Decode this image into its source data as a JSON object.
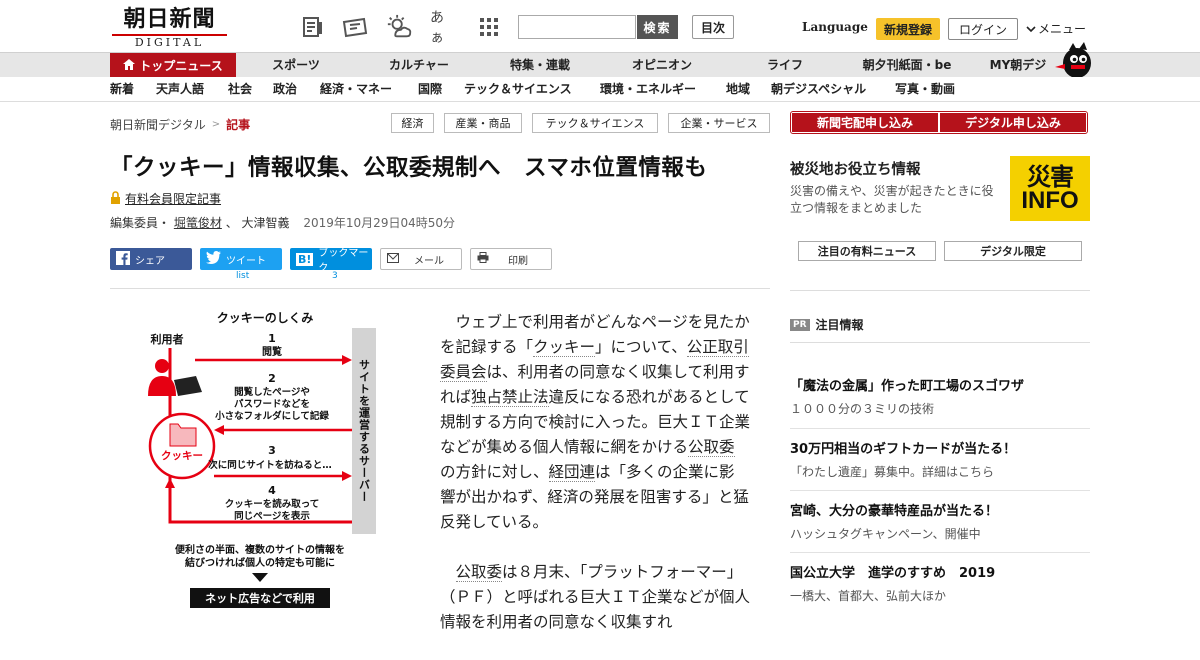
{
  "header": {
    "logo_jp": "朝日新聞",
    "logo_en": "DIGITAL",
    "search_placeholder": "",
    "search_button": "検索",
    "mokuji": "目次",
    "language": "Language",
    "register": "新規登録",
    "login": "ログイン",
    "menu": "メニュー",
    "font_size_label": "あぁ"
  },
  "nav_main": {
    "top": "トップニュース",
    "items": [
      "スポーツ",
      "カルチャー",
      "特集・連載",
      "オピニオン",
      "ライフ",
      "朝夕刊紙面・be",
      "MY朝デジ"
    ]
  },
  "nav_sub": {
    "items": [
      "新着",
      "天声人語",
      "社会",
      "政治",
      "経済・マネー",
      "国際",
      "テック＆サイエンス",
      "環境・エネルギー",
      "地域",
      "朝デジスペシャル",
      "写真・動画"
    ]
  },
  "breadcrumb": {
    "home": "朝日新聞デジタル",
    "sep": ">",
    "current": "記事"
  },
  "tags": [
    "経済",
    "産業・商品",
    "テック＆サイエンス",
    "企業・サービス"
  ],
  "article": {
    "headline": "「クッキー」情報収集、公取委規制へ　スマホ位置情報も",
    "members_only": "有料会員限定記事",
    "byline_prefix": "編集委員・",
    "author1": "堀篭俊材",
    "byline_sep": "、",
    "author2": "大津智義",
    "datetime": "2019年10月29日04時50分",
    "p1_a": "ウェブ上で利用者がどんなページを見たかを記録する「",
    "p1_link1": "クッキー",
    "p1_b": "」について、",
    "p1_link2": "公正取引委員会",
    "p1_c": "は、利用者の同意なく収集して利用すれば",
    "p1_link3": "独占禁止法",
    "p1_d": "違反になる恐れがあるとして規制する方向で検討に入った。巨大ＩＴ企業などが集める個人情報に網をかける",
    "p1_link4": "公取委",
    "p1_e": "の方針に対し、",
    "p1_link5": "経団連",
    "p1_f": "は「多くの企業に影響が出かねず、経済の発展を阻害する」と猛反発している。",
    "p2_link1": "公取委",
    "p2_a": "は８月末、「プラットフォーマー」（ＰＦ）と呼ばれる巨大ＩＴ企業などが個人情報を利用者の同意なく収集すれ"
  },
  "share": {
    "facebook": "シェア",
    "twitter": "ツイート",
    "twitter_count": "list",
    "hatena": "ブックマーク",
    "hatena_count": "3",
    "mail": "メール",
    "print": "印刷",
    "hatena_icon": "B!"
  },
  "figure": {
    "title": "クッキーのしくみ",
    "user_label": "利用者",
    "server_label": "サイトを運営するサーバー",
    "cookie_label": "クッキー",
    "step1_num": "1",
    "step1": "閲覧",
    "step2_num": "2",
    "step2_l1": "閲覧したページや",
    "step2_l2": "パスワードなどを",
    "step2_l3": "小さなフォルダにして記録",
    "step3_num": "3",
    "step3": "次に同じサイトを訪ねると…",
    "step4_num": "4",
    "step4_l1": "クッキーを読み取って",
    "step4_l2": "同じページを表示",
    "note_l1": "便利さの半面、複数のサイトの情報を",
    "note_l2": "結びつければ個人の特定も可能に",
    "result": "ネット広告などで利用",
    "accent_color": "#e60012"
  },
  "sidebar": {
    "delivery": "新聞宅配申し込み",
    "digital": "デジタル申し込み",
    "disaster_title": "被災地お役立ち情報",
    "disaster_desc": "災害の備えや、災害が起きたときに役立つ情報をまとめました",
    "disaster_logo_top": "災害",
    "disaster_logo_bottom": "INFO",
    "tab1": "注目の有料ニュース",
    "tab2": "デジタル限定",
    "pr_badge": "PR",
    "pr_title": "注目情報",
    "pr_items": [
      {
        "headline": "「魔法の金属」作った町工場のスゴワザ",
        "sub": "１０００分の３ミリの技術"
      },
      {
        "headline": "30万円相当のギフトカードが当たる！",
        "sub": "「わたし遺産」募集中。詳細はこちら"
      },
      {
        "headline": "宮崎、大分の豪華特産品が当たる！",
        "sub": "ハッシュタグキャンペーン、開催中"
      },
      {
        "headline": "国公立大学　進学のすすめ　2019",
        "sub": "一橋大、首都大、弘前大ほか"
      }
    ]
  },
  "colors": {
    "brand_red": "#b5121b",
    "register_yellow": "#f6c22a",
    "facebook": "#3b5998",
    "twitter": "#1da1f2",
    "hatena": "#008fde",
    "disaster_yellow": "#f4d000"
  }
}
